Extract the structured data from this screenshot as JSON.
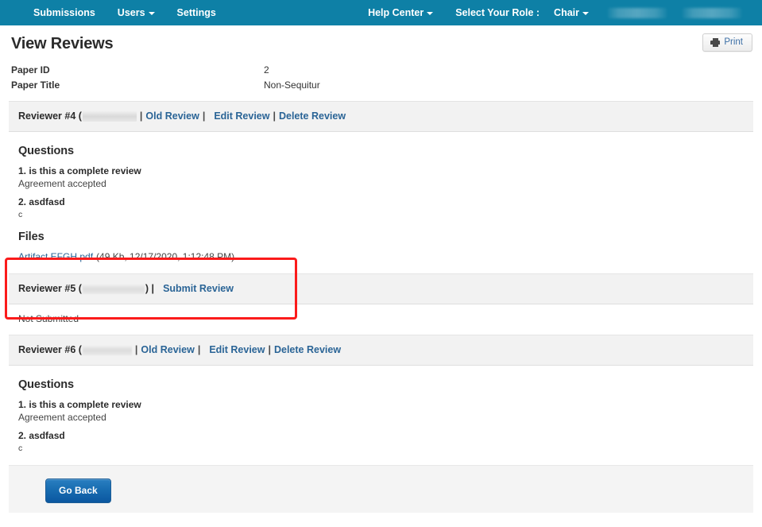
{
  "navbar": {
    "left_items": [
      {
        "label": "Submissions",
        "has_caret": false
      },
      {
        "label": "Users",
        "has_caret": true
      },
      {
        "label": "Settings",
        "has_caret": false
      }
    ],
    "help_center": {
      "label": "Help Center",
      "has_caret": true
    },
    "role_label": "Select Your Role :",
    "role_value": {
      "label": "Chair",
      "has_caret": true
    },
    "redacted_items": [
      "",
      ""
    ],
    "background_color": "#0e80a6"
  },
  "header": {
    "title": "View Reviews",
    "print_button": "Print",
    "print_icon": "printer-icon"
  },
  "meta": [
    {
      "label": "Paper ID",
      "value": "2"
    },
    {
      "label": "Paper Title",
      "value": "Non-Sequitur"
    }
  ],
  "reviewers": [
    {
      "title": "Reviewer #4 (",
      "name_redacted": true,
      "title_close": "",
      "links": [
        "Old Review",
        "Edit Review",
        "Delete Review"
      ],
      "submitted": true,
      "questions_heading": "Questions",
      "questions": [
        {
          "q": "1. is this a complete review",
          "a": "Agreement accepted"
        },
        {
          "q": "2. asdfasd",
          "a": "c"
        }
      ],
      "files_heading": "Files",
      "files": [
        {
          "name": "Artifact EFGH.pdf",
          "meta": "(49 Kb, 12/17/2020, 1:12:48 PM)"
        }
      ]
    },
    {
      "title": "Reviewer #5 (",
      "name_redacted": true,
      "title_close": ") |",
      "links": [
        "Submit Review"
      ],
      "submitted": false,
      "status_text": "Not Submitted",
      "highlighted": true
    },
    {
      "title": "Reviewer #6 (",
      "name_redacted": true,
      "title_close": "",
      "links": [
        "Old Review",
        "Edit Review",
        "Delete Review"
      ],
      "submitted": true,
      "questions_heading": "Questions",
      "questions": [
        {
          "q": "1. is this a complete review",
          "a": "Agreement accepted"
        },
        {
          "q": "2. asdfasd",
          "a": "c"
        }
      ]
    }
  ],
  "footer": {
    "go_back": "Go Back"
  },
  "annotation": {
    "color": "#fb1b1b",
    "target": "reviewer-5-panel"
  }
}
